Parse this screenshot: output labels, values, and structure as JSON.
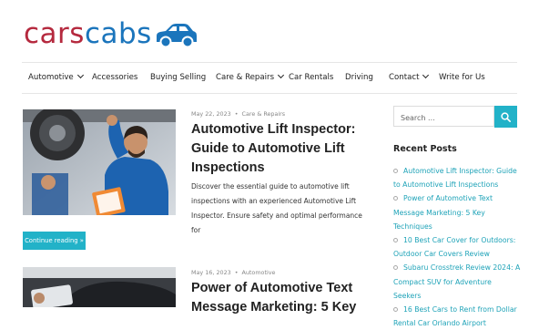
{
  "brand": {
    "part1": "cars",
    "part2": "cabs"
  },
  "nav": {
    "items": [
      {
        "label": "Automotive"
      },
      {
        "label": "Accessories"
      },
      {
        "label": "Buying Selling"
      },
      {
        "label": "Care & Repairs"
      },
      {
        "label": "Car Rentals"
      },
      {
        "label": "Driving"
      },
      {
        "label": "Contact"
      },
      {
        "label": "Write for Us"
      }
    ]
  },
  "posts": [
    {
      "date": "May 22, 2023",
      "category": "Care & Repairs",
      "title": "Automotive Lift Inspector: Guide to Automotive Lift Inspections",
      "excerpt": "Discover the essential guide to automotive lift inspections with an experienced Automotive Lift Inspector. Ensure safety and optimal performance for",
      "button": "Continue reading »"
    },
    {
      "date": "May 16, 2023",
      "category": "Automotive",
      "title": "Power of Automotive Text Message Marketing: 5 Key"
    }
  ],
  "sidebar": {
    "search_placeholder": "Search ...",
    "recent_title": "Recent Posts",
    "recent": [
      "Automotive Lift Inspector: Guide to Automotive Lift Inspections",
      "Power of Automotive Text Message Marketing: 5 Key Techniques",
      "10 Best Car Cover for Outdoors: Outdoor Car Covers Review",
      "Subaru Crosstrek Review 2024: A Compact SUV for Adventure Seekers",
      "16 Best Cars to Rent from Dollar Rental Car Orlando Airport"
    ]
  },
  "colors": {
    "brand_red": "#b5293e",
    "brand_blue": "#1b75bc",
    "accent": "#22b2c8"
  }
}
